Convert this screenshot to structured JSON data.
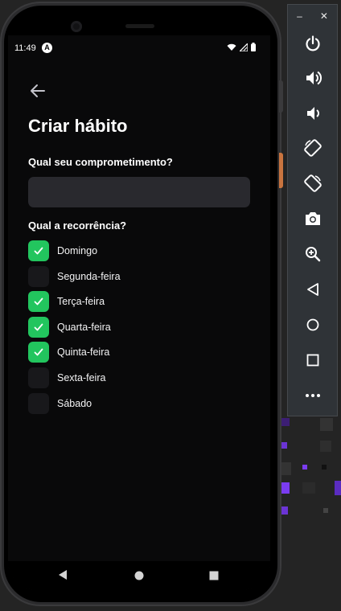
{
  "status_bar": {
    "time": "11:49",
    "notification_icon": "a-circle-icon",
    "icons": [
      "wifi-icon",
      "signal-icon",
      "battery-icon"
    ]
  },
  "header": {
    "back_icon": "arrow-left-icon",
    "title": "Criar hábito"
  },
  "form": {
    "commitment_label": "Qual seu comprometimento?",
    "commitment_value": "",
    "recurrence_label": "Qual a recorrência?",
    "days": [
      {
        "label": "Domingo",
        "checked": true
      },
      {
        "label": "Segunda-feira",
        "checked": false
      },
      {
        "label": "Terça-feira",
        "checked": true
      },
      {
        "label": "Quarta-feira",
        "checked": true
      },
      {
        "label": "Quinta-feira",
        "checked": true
      },
      {
        "label": "Sexta-feira",
        "checked": false
      },
      {
        "label": "Sábado",
        "checked": false
      }
    ]
  },
  "nav_bar": [
    "back-triangle-icon",
    "home-circle-icon",
    "recents-square-icon"
  ],
  "emulator_toolbar": {
    "window_controls": [
      "minimize-icon",
      "close-icon"
    ],
    "buttons": [
      "power-icon",
      "volume-up-icon",
      "volume-down-icon",
      "rotate-left-icon",
      "rotate-right-icon",
      "screenshot-icon",
      "zoom-icon",
      "back-icon",
      "home-icon",
      "overview-icon",
      "more-icon"
    ]
  },
  "colors": {
    "accent_green": "#22c55e",
    "screen_bg": "#09090a",
    "input_bg": "#29292e",
    "unchecked_box": "#18181b"
  }
}
